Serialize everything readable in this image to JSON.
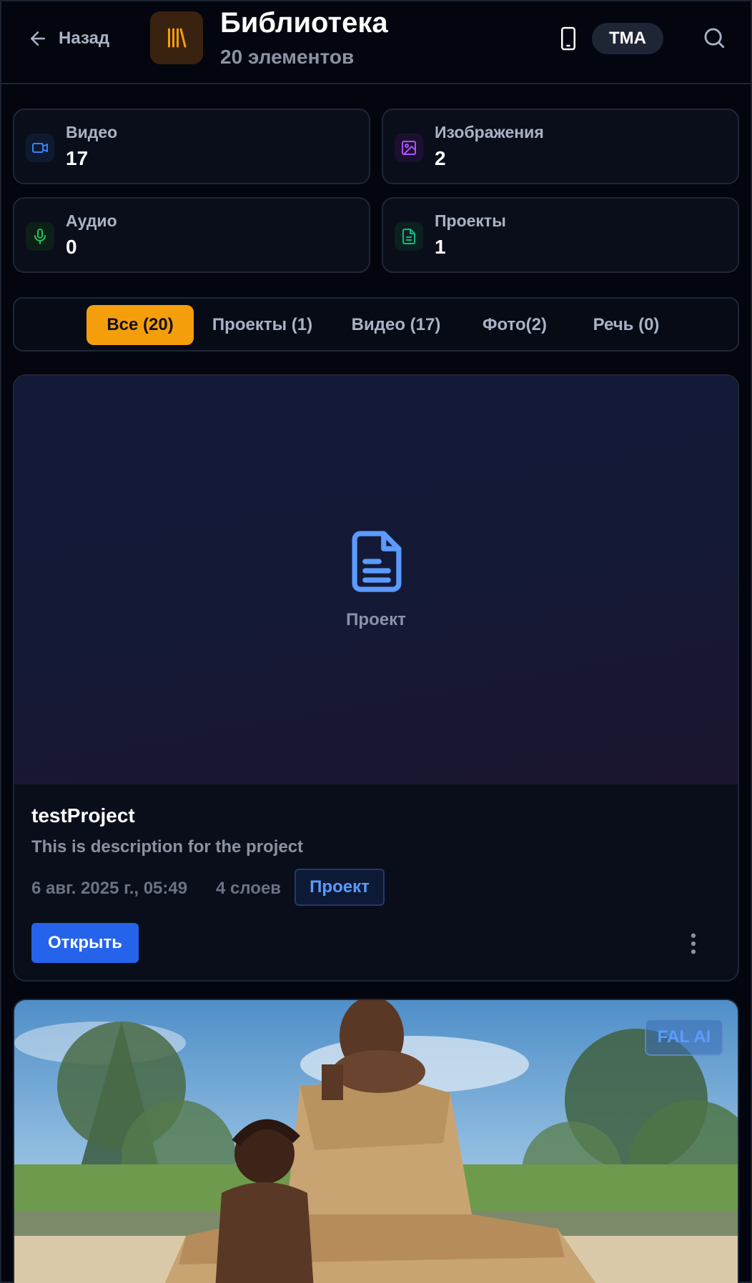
{
  "header": {
    "back_label": "Назад",
    "title": "Библиотека",
    "subtitle": "20 элементов",
    "badge": "TMA"
  },
  "stats": [
    {
      "label": "Видео",
      "value": "17",
      "icon": "video-icon",
      "color": "#3b82f6"
    },
    {
      "label": "Изображения",
      "value": "2",
      "icon": "image-icon",
      "color": "#a855f7"
    },
    {
      "label": "Аудио",
      "value": "0",
      "icon": "mic-icon",
      "color": "#22c55e"
    },
    {
      "label": "Проекты",
      "value": "1",
      "icon": "document-icon",
      "color": "#10b981"
    }
  ],
  "tabs": [
    {
      "label": "Все (20)",
      "active": true
    },
    {
      "label": "Проекты (1)",
      "active": false
    },
    {
      "label": "Видео (17)",
      "active": false
    },
    {
      "label": "Фото(2)",
      "active": false
    },
    {
      "label": "Речь (0)",
      "active": false
    }
  ],
  "project_card": {
    "preview_label": "Проект",
    "name": "testProject",
    "description": "This is description for the project",
    "date": "6 авг. 2025 г., 05:49",
    "layers": "4 слоев",
    "badge": "Проект",
    "open_label": "Открыть"
  },
  "image_card": {
    "badge": "FAL AI"
  },
  "colors": {
    "accent": "#f59e0b",
    "primary_button": "#2563eb",
    "background": "#03060f"
  }
}
